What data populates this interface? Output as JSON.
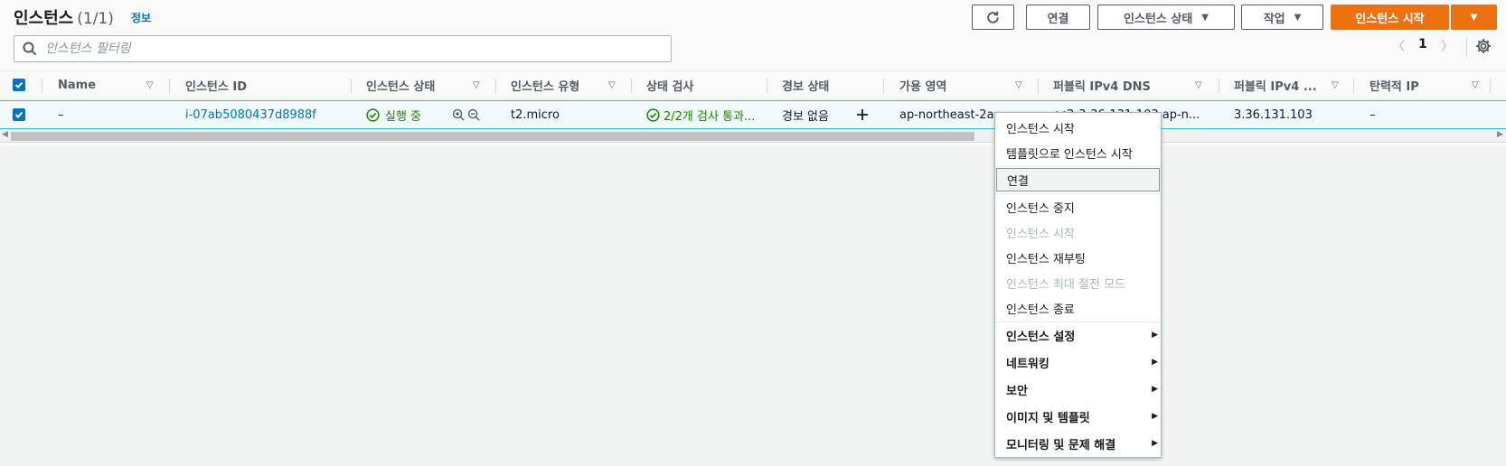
{
  "header": {
    "title": "인스턴스",
    "count": "(1/1)",
    "info_link": "정보"
  },
  "toolbar": {
    "refresh_icon": "refresh-icon",
    "connect_label": "연결",
    "instance_state_label": "인스턴스 상태",
    "actions_label": "작업",
    "launch_label": "인스턴스 시작"
  },
  "search": {
    "placeholder": "인스턴스 필터링"
  },
  "pagination": {
    "prev": "〈",
    "page": "1",
    "next": "〉"
  },
  "table": {
    "columns": [
      "Name",
      "인스턴스 ID",
      "인스턴스 상태",
      "인스턴스 유형",
      "상태 검사",
      "경보 상태",
      "가용 영역",
      "퍼블릭 IPv4 DNS",
      "퍼블릭 IPv4 ...",
      "탄력적 IP"
    ],
    "rows": [
      {
        "name": "–",
        "instance_id": "i-07ab5080437d8988f",
        "state": "실행 중",
        "type": "t2.micro",
        "status_check": "2/2개 검사 통과...",
        "alarm_status": "경보 없음",
        "az": "ap-northeast-2a",
        "public_dns": "ec2-3-36-131-103.ap-n...",
        "public_ip": "3.36.131.103",
        "elastic_ip": "–"
      }
    ]
  },
  "context_menu": {
    "items": [
      {
        "label": "인스턴스 시작"
      },
      {
        "label": "템플릿으로 인스턴스 시작"
      },
      {
        "label": "연결"
      },
      {
        "label": "인스턴스 중지"
      },
      {
        "label": "인스턴스 시작"
      },
      {
        "label": "인스턴스 재부팅"
      },
      {
        "label": "인스턴스 최대 절전 모드"
      },
      {
        "label": "인스턴스 종료"
      },
      {
        "label": "인스턴스 설정"
      },
      {
        "label": "네트워킹"
      },
      {
        "label": "보안"
      },
      {
        "label": "이미지 및 템플릿"
      },
      {
        "label": "모니터링 및 문제 해결"
      }
    ]
  },
  "colors": {
    "accent": "#0073bb",
    "primary_button": "#ec7211",
    "success": "#1d8102"
  }
}
